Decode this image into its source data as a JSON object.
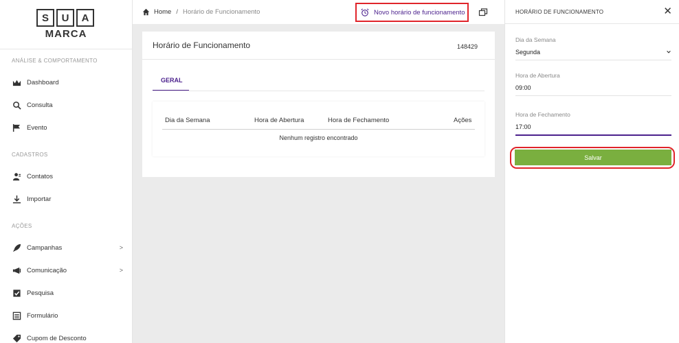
{
  "logo": {
    "letters": [
      "S",
      "U",
      "A"
    ],
    "text": "MARCA"
  },
  "sidebar": {
    "sections": [
      {
        "title": "ANÁLISE & COMPORTAMENTO"
      },
      {
        "title": "CADASTROS"
      },
      {
        "title": "AÇÕES"
      }
    ],
    "items": [
      {
        "label": "Dashboard",
        "icon": "dashboard-icon"
      },
      {
        "label": "Consulta",
        "icon": "search-icon"
      },
      {
        "label": "Evento",
        "icon": "flag-icon"
      },
      {
        "label": "Contatos",
        "icon": "contacts-icon"
      },
      {
        "label": "Importar",
        "icon": "download-icon"
      },
      {
        "label": "Campanhas",
        "icon": "rocket-icon",
        "has_submenu": true
      },
      {
        "label": "Comunicação",
        "icon": "megaphone-icon",
        "has_submenu": true
      },
      {
        "label": "Pesquisa",
        "icon": "checklist-icon"
      },
      {
        "label": "Formulário",
        "icon": "form-icon"
      },
      {
        "label": "Cupom de Desconto",
        "icon": "coupon-icon"
      }
    ]
  },
  "topbar": {
    "breadcrumb": {
      "home": "Home",
      "separator": "/",
      "current": "Horário de Funcionamento"
    },
    "new_button_label": "Novo horário de funcionamento"
  },
  "card": {
    "title": "Horário de Funcionamento",
    "id": "148429",
    "tab_label": "GERAL",
    "table": {
      "columns": [
        "Dia da Semana",
        "Hora de Abertura",
        "Hora de Fechamento",
        "Ações"
      ],
      "empty_message": "Nenhum registro encontrado"
    }
  },
  "panel": {
    "title": "HORÁRIO DE FUNCIONAMENTO",
    "close_symbol": "✕",
    "fields": {
      "day": {
        "label": "Dia da Semana",
        "value": "Segunda"
      },
      "open": {
        "label": "Hora de Abertura",
        "value": "09:00"
      },
      "close": {
        "label": "Hora de Fechamento",
        "value": "17:00"
      }
    },
    "save_label": "Salvar"
  },
  "colors": {
    "accent": "#4a1f8c",
    "highlight": "#e0242a",
    "save_button": "#7aaf3f"
  }
}
